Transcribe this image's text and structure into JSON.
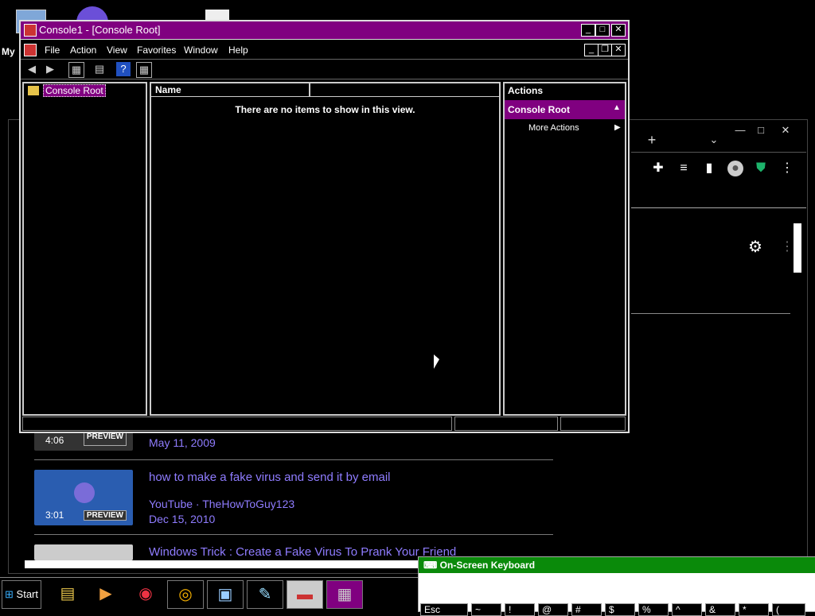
{
  "desktop": {
    "my_computer_label": "My"
  },
  "browser": {
    "results": [
      {
        "duration": "4:06",
        "preview": "PREVIEW",
        "date": "May 11, 2009"
      },
      {
        "title": "how to make a fake virus and send it by email",
        "source": "YouTube · TheHowToGuy123",
        "date": "Dec 15, 2010",
        "duration": "3:01",
        "preview": "PREVIEW"
      },
      {
        "title": "Windows Trick : Create a Fake Virus To Prank Your Friend"
      }
    ]
  },
  "mmc": {
    "title": "Console1 - [Console Root]",
    "menu": [
      "File",
      "Action",
      "View",
      "Favorites",
      "Window",
      "Help"
    ],
    "tree_root": "Console Root",
    "list_header_name": "Name",
    "empty_message": "There are no items to show in this view.",
    "actions_header": "Actions",
    "actions_section": "Console Root",
    "more_actions": "More Actions"
  },
  "taskbar": {
    "start_label": "Start"
  },
  "osk": {
    "title": "On-Screen Keyboard",
    "keys": [
      "Esc",
      "~",
      "!",
      "@",
      "#",
      "$",
      "%",
      "^",
      "&",
      "*",
      "("
    ]
  },
  "colors": {
    "title_bar": "#800080",
    "selection": "#800080",
    "link": "#8f7cff",
    "osk_title": "#0a8a0a"
  }
}
